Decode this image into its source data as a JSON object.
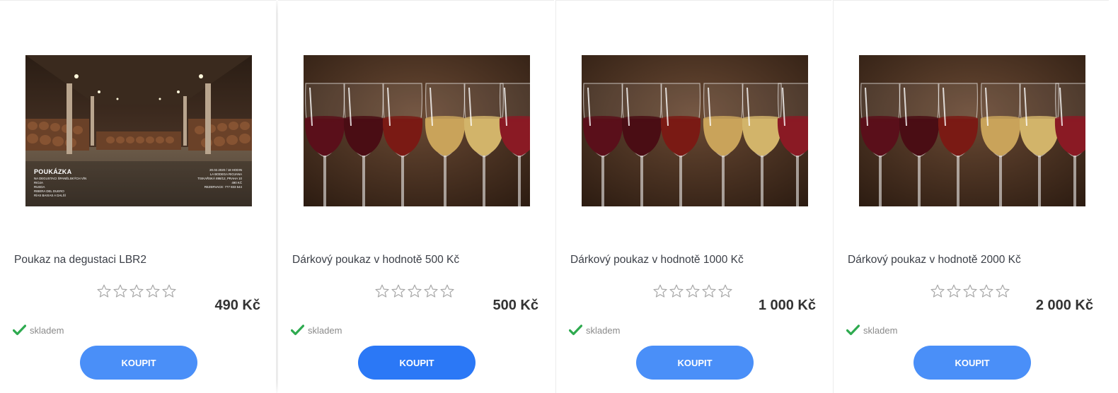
{
  "colors": {
    "button": "#4a8ff8",
    "button_active": "#2b78f6",
    "stock_check": "#2eaa4f",
    "star_outline": "#a8a8a8",
    "name_text": "#3b3f47",
    "price_text": "#333333"
  },
  "voucher_text": {
    "title": "POUKÁZKA",
    "left_lines": [
      "NA DEGUSTACI ŠPANĚLSKÝCH VÍN",
      "RIOJA",
      "RUEDA",
      "RIBERA DEL DUERO",
      "RÍAS BAIXAS A DALŠÍ"
    ],
    "right_lines": [
      "20.02.2020 / 18 HODIN",
      "",
      "LA BODEGA RIOJANA",
      "TISKAŘSKÁ 898/12, PRAHA 10",
      "",
      "490 KČ",
      "REZERVACE: 777 833 544"
    ]
  },
  "products": [
    {
      "name": "Poukaz na degustaci LBR2",
      "price": "490 Kč",
      "rating": 0,
      "rating_max": 5,
      "stock": "skladem",
      "buy_label": "KOUPIT",
      "image": "wine-cellar-voucher"
    },
    {
      "name": "Dárkový poukaz v hodnotě 500 Kč",
      "price": "500 Kč",
      "rating": 0,
      "rating_max": 5,
      "stock": "skladem",
      "buy_label": "KOUPIT",
      "image": "wine-glasses"
    },
    {
      "name": "Dárkový poukaz v hodnotě 1000 Kč",
      "price": "1 000 Kč",
      "rating": 0,
      "rating_max": 5,
      "stock": "skladem",
      "buy_label": "KOUPIT",
      "image": "wine-glasses"
    },
    {
      "name": "Dárkový poukaz v hodnotě 2000 Kč",
      "price": "2 000 Kč",
      "rating": 0,
      "rating_max": 5,
      "stock": "skladem",
      "buy_label": "KOUPIT",
      "image": "wine-glasses"
    }
  ]
}
